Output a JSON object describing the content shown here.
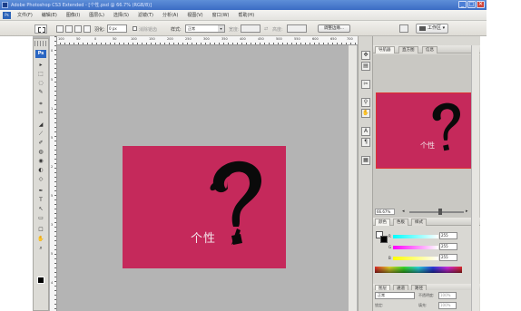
{
  "window": {
    "title": "Adobe Photoshop CS3 Extended - [个性.psd @ 66.7% (RGB/8)]",
    "minimize": "_",
    "maximize": "□",
    "close": "✕"
  },
  "menu": {
    "ps_badge": "Ps",
    "items": [
      "文件(F)",
      "编辑(E)",
      "图像(I)",
      "图层(L)",
      "选择(S)",
      "滤镜(T)",
      "分析(A)",
      "视图(V)",
      "窗口(W)",
      "帮助(H)"
    ]
  },
  "options": {
    "feather_label": "羽化:",
    "feather_value": "0 px",
    "antialias_label": "消除锯齿",
    "style_label": "样式:",
    "style_value": "正常",
    "width_label": "宽度:",
    "height_label": "高度:",
    "refine_edge": "调整边缘...",
    "workspace": "工作区 ▾"
  },
  "toolbox": {
    "logo": "Ps",
    "tools": [
      "▸",
      "⬚",
      "◌",
      "✎",
      "⌗",
      "✂",
      "◢",
      "⟋",
      "✐",
      "◍",
      "◉",
      "◐",
      "◇",
      "✒",
      "T",
      "↖",
      "▭",
      "☐",
      "✋",
      "⌕"
    ]
  },
  "ruler": {
    "h_ticks": [
      "100",
      "50",
      "0",
      "50",
      "100",
      "150",
      "200",
      "250",
      "300",
      "350",
      "400",
      "450",
      "500",
      "550",
      "600",
      "650",
      "700"
    ],
    "v_ticks": [
      "0",
      "5",
      "1",
      "5",
      "2",
      "5",
      "3",
      "5",
      "4"
    ]
  },
  "document": {
    "background": "#c5295b",
    "caption": "个性"
  },
  "dock": {
    "icons": [
      "✥",
      "▤",
      "✂",
      "⚲",
      "✋",
      "A",
      "¶",
      "▦"
    ]
  },
  "navigator_panel": {
    "tabs": [
      "导航器",
      "直方图",
      "信息"
    ],
    "active_tab": "导航器",
    "zoom": "66.67%",
    "minus": "◂",
    "plus": "▸",
    "thumb_caption": "个性"
  },
  "color_panel": {
    "tabs": [
      "颜色",
      "色板",
      "样式"
    ],
    "active_tab": "颜色",
    "channels": [
      {
        "label": "R",
        "value": "255"
      },
      {
        "label": "G",
        "value": "255"
      },
      {
        "label": "B",
        "value": "255"
      }
    ]
  },
  "layers_panel": {
    "tabs": [
      "图层",
      "通道",
      "路径"
    ],
    "active_tab": "图层",
    "blend_mode": "正常",
    "opacity_label": "不透明度:",
    "opacity_value": "100%",
    "lock_label": "锁定:",
    "fill_label": "填充:",
    "fill_value": "100%"
  },
  "colors": {
    "accent_title": "#3b6cc4",
    "canvas": "#c5295b",
    "workarea": "#b4b4b4"
  }
}
